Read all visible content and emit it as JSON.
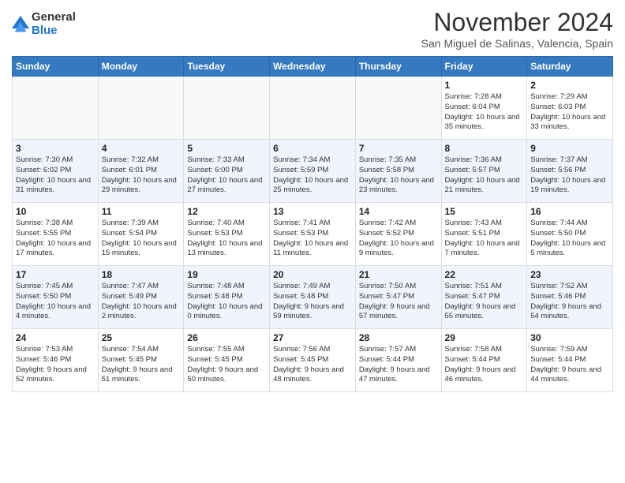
{
  "header": {
    "logo_general": "General",
    "logo_blue": "Blue",
    "title": "November 2024",
    "location": "San Miguel de Salinas, Valencia, Spain"
  },
  "calendar": {
    "days_of_week": [
      "Sunday",
      "Monday",
      "Tuesday",
      "Wednesday",
      "Thursday",
      "Friday",
      "Saturday"
    ],
    "weeks": [
      [
        {
          "day": "",
          "info": ""
        },
        {
          "day": "",
          "info": ""
        },
        {
          "day": "",
          "info": ""
        },
        {
          "day": "",
          "info": ""
        },
        {
          "day": "",
          "info": ""
        },
        {
          "day": "1",
          "info": "Sunrise: 7:28 AM\nSunset: 6:04 PM\nDaylight: 10 hours and 35 minutes."
        },
        {
          "day": "2",
          "info": "Sunrise: 7:29 AM\nSunset: 6:03 PM\nDaylight: 10 hours and 33 minutes."
        }
      ],
      [
        {
          "day": "3",
          "info": "Sunrise: 7:30 AM\nSunset: 6:02 PM\nDaylight: 10 hours and 31 minutes."
        },
        {
          "day": "4",
          "info": "Sunrise: 7:32 AM\nSunset: 6:01 PM\nDaylight: 10 hours and 29 minutes."
        },
        {
          "day": "5",
          "info": "Sunrise: 7:33 AM\nSunset: 6:00 PM\nDaylight: 10 hours and 27 minutes."
        },
        {
          "day": "6",
          "info": "Sunrise: 7:34 AM\nSunset: 5:59 PM\nDaylight: 10 hours and 25 minutes."
        },
        {
          "day": "7",
          "info": "Sunrise: 7:35 AM\nSunset: 5:58 PM\nDaylight: 10 hours and 23 minutes."
        },
        {
          "day": "8",
          "info": "Sunrise: 7:36 AM\nSunset: 5:57 PM\nDaylight: 10 hours and 21 minutes."
        },
        {
          "day": "9",
          "info": "Sunrise: 7:37 AM\nSunset: 5:56 PM\nDaylight: 10 hours and 19 minutes."
        }
      ],
      [
        {
          "day": "10",
          "info": "Sunrise: 7:38 AM\nSunset: 5:55 PM\nDaylight: 10 hours and 17 minutes."
        },
        {
          "day": "11",
          "info": "Sunrise: 7:39 AM\nSunset: 5:54 PM\nDaylight: 10 hours and 15 minutes."
        },
        {
          "day": "12",
          "info": "Sunrise: 7:40 AM\nSunset: 5:53 PM\nDaylight: 10 hours and 13 minutes."
        },
        {
          "day": "13",
          "info": "Sunrise: 7:41 AM\nSunset: 5:53 PM\nDaylight: 10 hours and 11 minutes."
        },
        {
          "day": "14",
          "info": "Sunrise: 7:42 AM\nSunset: 5:52 PM\nDaylight: 10 hours and 9 minutes."
        },
        {
          "day": "15",
          "info": "Sunrise: 7:43 AM\nSunset: 5:51 PM\nDaylight: 10 hours and 7 minutes."
        },
        {
          "day": "16",
          "info": "Sunrise: 7:44 AM\nSunset: 5:50 PM\nDaylight: 10 hours and 5 minutes."
        }
      ],
      [
        {
          "day": "17",
          "info": "Sunrise: 7:45 AM\nSunset: 5:50 PM\nDaylight: 10 hours and 4 minutes."
        },
        {
          "day": "18",
          "info": "Sunrise: 7:47 AM\nSunset: 5:49 PM\nDaylight: 10 hours and 2 minutes."
        },
        {
          "day": "19",
          "info": "Sunrise: 7:48 AM\nSunset: 5:48 PM\nDaylight: 10 hours and 0 minutes."
        },
        {
          "day": "20",
          "info": "Sunrise: 7:49 AM\nSunset: 5:48 PM\nDaylight: 9 hours and 59 minutes."
        },
        {
          "day": "21",
          "info": "Sunrise: 7:50 AM\nSunset: 5:47 PM\nDaylight: 9 hours and 57 minutes."
        },
        {
          "day": "22",
          "info": "Sunrise: 7:51 AM\nSunset: 5:47 PM\nDaylight: 9 hours and 55 minutes."
        },
        {
          "day": "23",
          "info": "Sunrise: 7:52 AM\nSunset: 5:46 PM\nDaylight: 9 hours and 54 minutes."
        }
      ],
      [
        {
          "day": "24",
          "info": "Sunrise: 7:53 AM\nSunset: 5:46 PM\nDaylight: 9 hours and 52 minutes."
        },
        {
          "day": "25",
          "info": "Sunrise: 7:54 AM\nSunset: 5:45 PM\nDaylight: 9 hours and 51 minutes."
        },
        {
          "day": "26",
          "info": "Sunrise: 7:55 AM\nSunset: 5:45 PM\nDaylight: 9 hours and 50 minutes."
        },
        {
          "day": "27",
          "info": "Sunrise: 7:56 AM\nSunset: 5:45 PM\nDaylight: 9 hours and 48 minutes."
        },
        {
          "day": "28",
          "info": "Sunrise: 7:57 AM\nSunset: 5:44 PM\nDaylight: 9 hours and 47 minutes."
        },
        {
          "day": "29",
          "info": "Sunrise: 7:58 AM\nSunset: 5:44 PM\nDaylight: 9 hours and 46 minutes."
        },
        {
          "day": "30",
          "info": "Sunrise: 7:59 AM\nSunset: 5:44 PM\nDaylight: 9 hours and 44 minutes."
        }
      ]
    ]
  }
}
